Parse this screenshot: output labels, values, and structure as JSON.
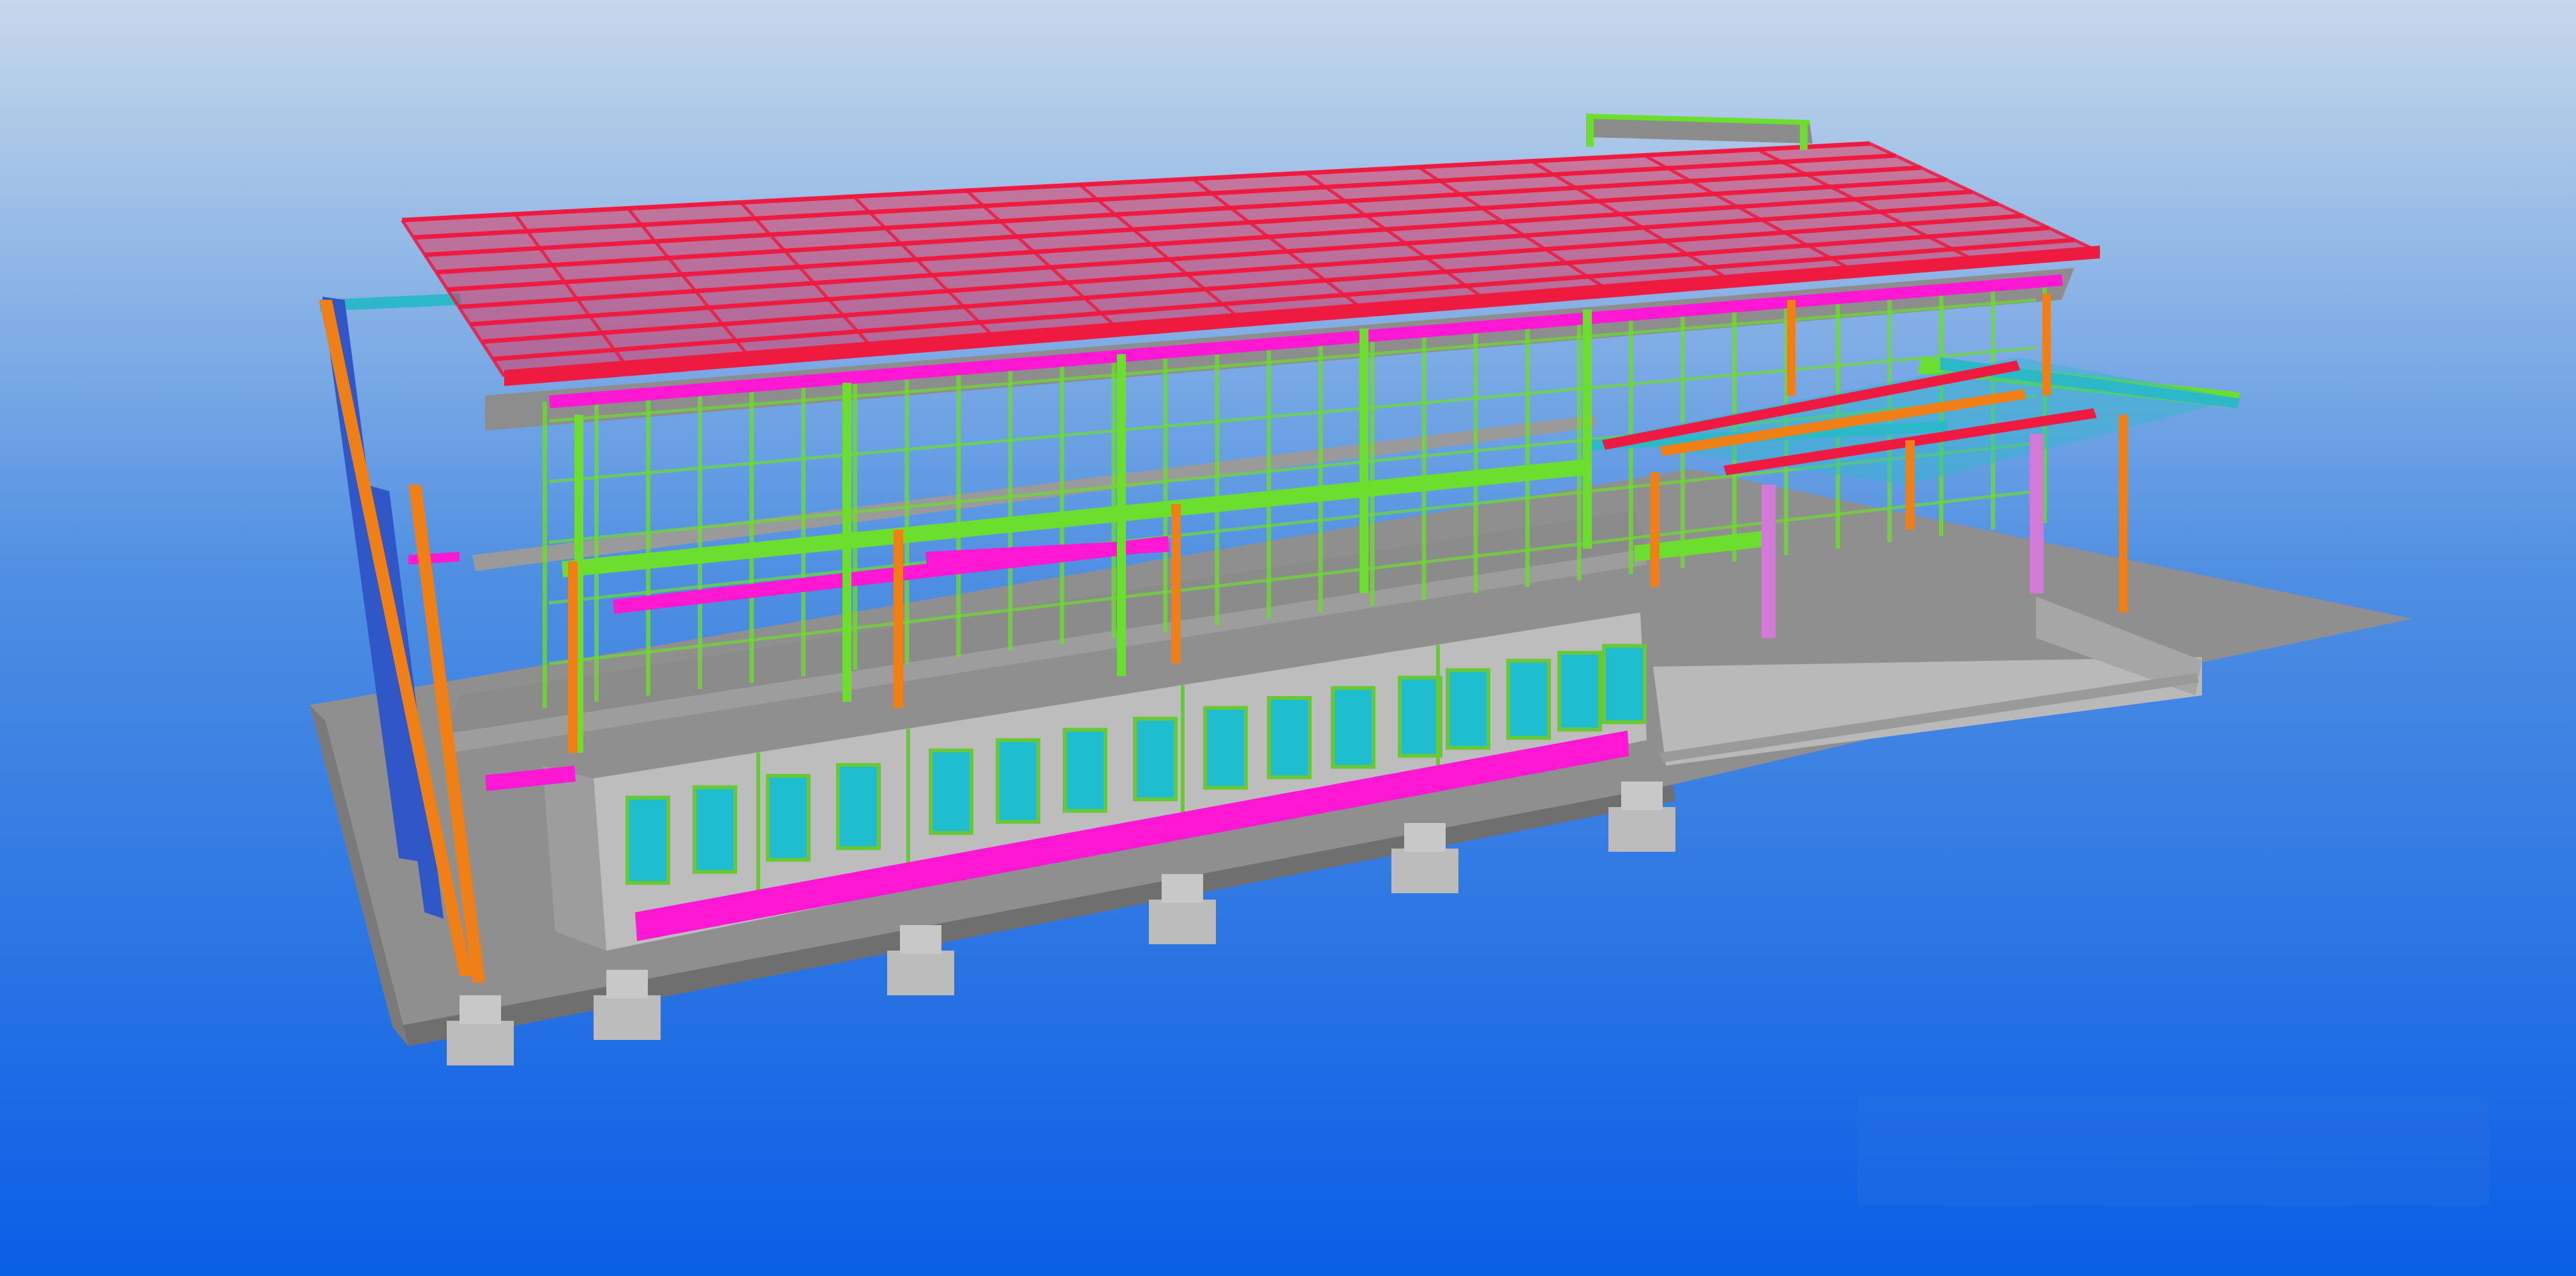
{
  "viewport": {
    "background_top": "#c6d8ea",
    "background_mid": "#4f8fe2",
    "background_bottom": "#0a5ee6"
  },
  "model": {
    "element_colors": {
      "slab": "#a3a3a3",
      "slab_dark": "#7f7f7f",
      "slab_light": "#c8c8c8",
      "wall": "#bdbdbd",
      "column": "#f07f15",
      "column_alt": "#d37ad9",
      "beam_primary": "#ff0fd0",
      "beam_secondary": "#6cde2e",
      "beam_tertiary": "#2cb8c9",
      "bracing": "#2f57c8",
      "roof_truss": "#ee1a40",
      "window": "#1ebdd0",
      "frame": "#68c835",
      "footing": "#bcbcbc"
    }
  },
  "overlay": {
    "panel_bg": "#2a6fe0"
  }
}
